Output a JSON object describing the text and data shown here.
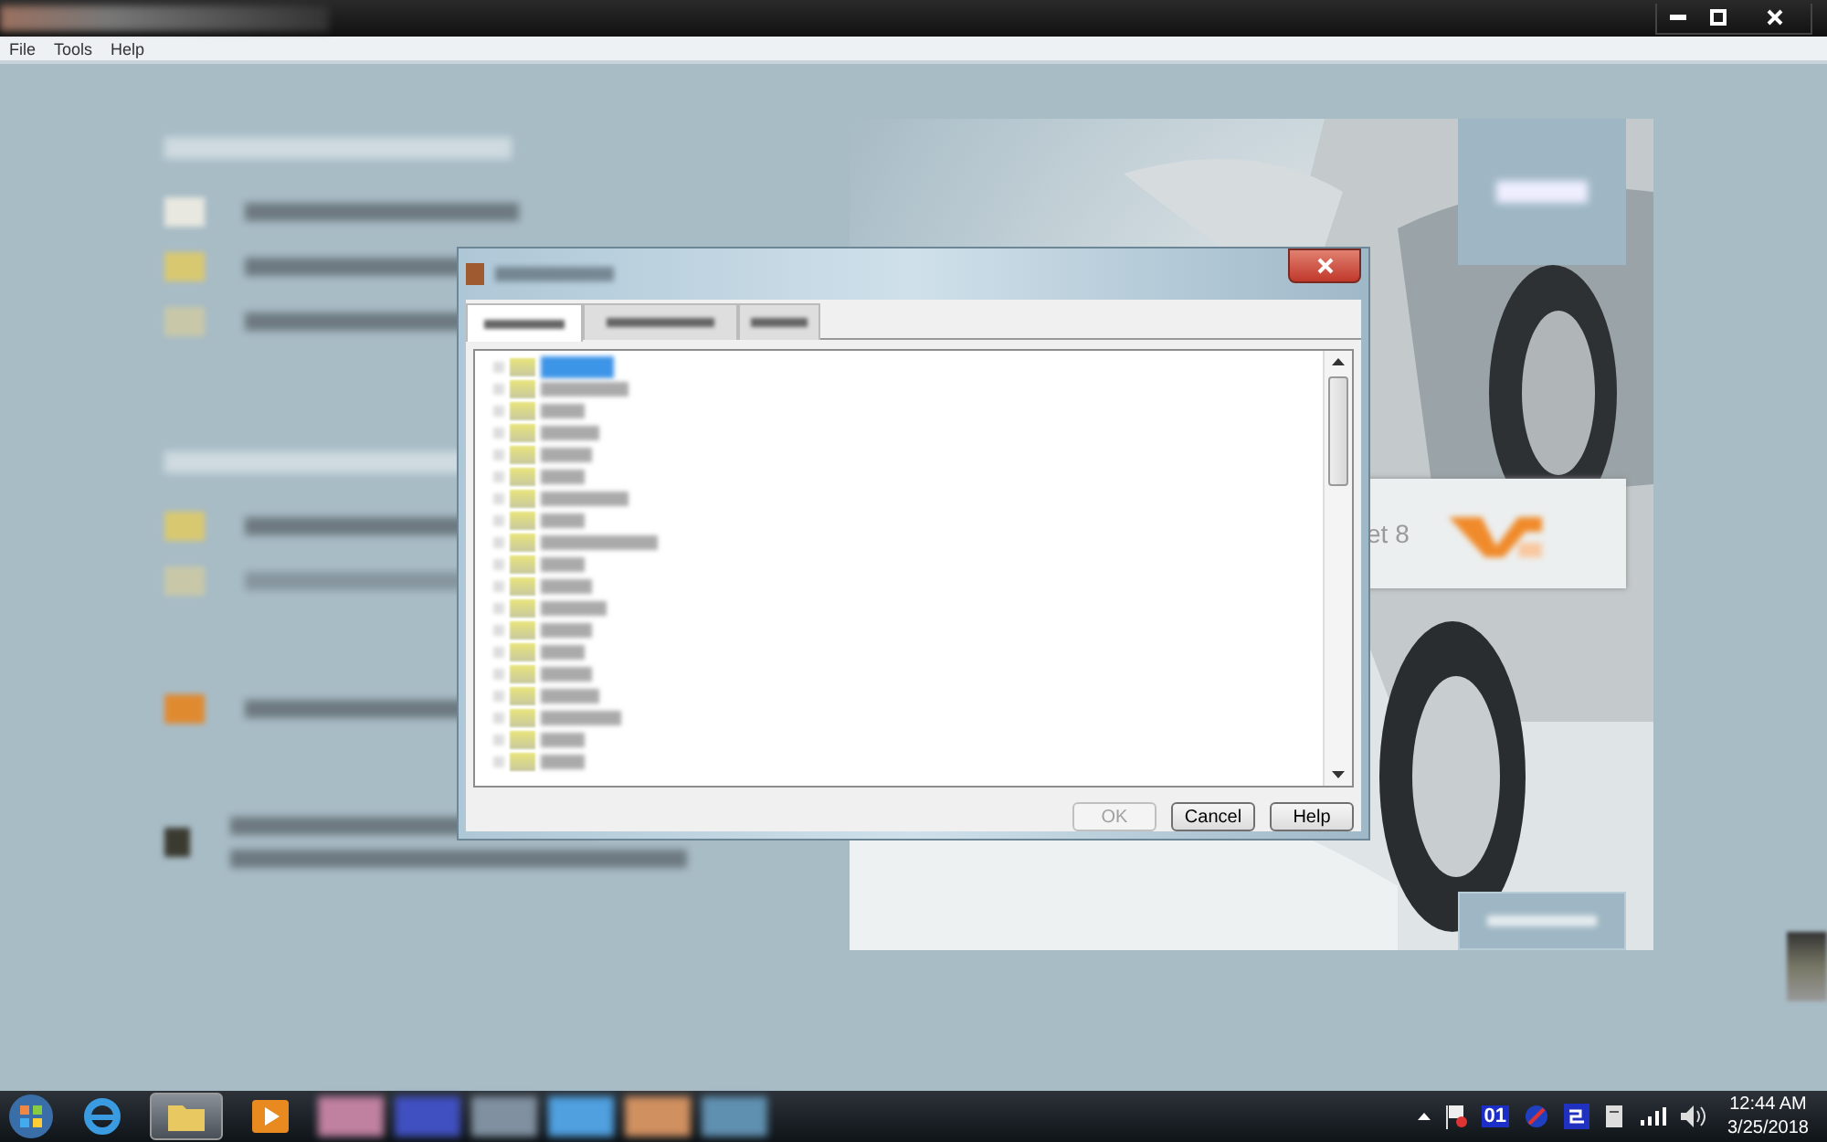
{
  "menu": [
    "File",
    "Tools",
    "Help"
  ],
  "card": {
    "label": "et 8"
  },
  "dialog": {
    "tabs": [
      {
        "selected": true
      },
      {
        "selected": false
      },
      {
        "selected": false
      }
    ],
    "tree_items": [
      {
        "selected": true
      },
      {
        "selected": false
      },
      {
        "selected": false
      },
      {
        "selected": false
      },
      {
        "selected": false
      },
      {
        "selected": false
      },
      {
        "selected": false
      },
      {
        "selected": false
      },
      {
        "selected": false
      },
      {
        "selected": false
      },
      {
        "selected": false
      },
      {
        "selected": false
      },
      {
        "selected": false
      },
      {
        "selected": false
      },
      {
        "selected": false
      },
      {
        "selected": false
      },
      {
        "selected": false
      },
      {
        "selected": false
      },
      {
        "selected": false
      }
    ],
    "buttons": [
      {
        "label": "OK",
        "disabled": true
      },
      {
        "label": "Cancel",
        "disabled": false
      },
      {
        "label": "Help",
        "disabled": false
      }
    ]
  },
  "taskbar": {
    "tray_badge": "01",
    "time": "12:44 AM",
    "date": "3/25/2018"
  }
}
